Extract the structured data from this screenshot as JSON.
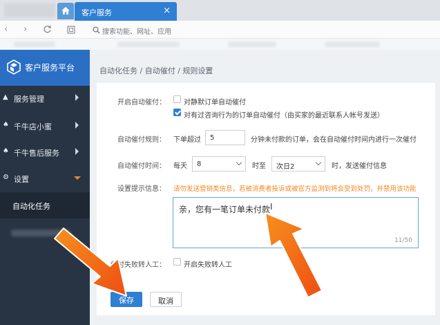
{
  "browser": {
    "tab_title": "客户服务",
    "tab_close": "×",
    "address_placeholder": "搜索功能、网址、应用"
  },
  "sidebar": {
    "brand": "客户服务平台",
    "items": [
      {
        "label": "服务管理"
      },
      {
        "label": "千牛店小蜜"
      },
      {
        "label": "千牛售后服务"
      },
      {
        "label": "设置"
      }
    ],
    "submenu": "自动化任务"
  },
  "breadcrumb": "自动化任务 / 自动催付 /  规则设置",
  "form": {
    "enable_label": "开启自动催付：",
    "opt1": "对静默订单自动催付",
    "opt2": "对有过咨询行为的订单自动催付（由买家的最近联系人帐号发送）",
    "opt1_checked": false,
    "opt2_checked": true,
    "rule_label": "自动催付规则：",
    "rule_prefix": "下单超过",
    "rule_value": "5",
    "rule_suffix": "分钟未付款的订单，会在自动催付时间内进行一次催付",
    "time_label": "自动催付时间：",
    "time_prefix": "每天",
    "time_from": "8",
    "time_mid": "时至",
    "time_to": "次日2",
    "time_suffix": "时，发送催付信息",
    "msg_label": "设置提示信息：",
    "warning": "请勿发送营销类信息，若被消费者投诉或被官方监测到将会受到处罚，并禁用该功能",
    "message": "亲，您有一笔订单未付款",
    "caret": "I",
    "count": "11/50",
    "fail_label": "催付失败转人工：",
    "fail_option": "开启失败转人工",
    "fail_checked": false
  },
  "buttons": {
    "save": "保存",
    "cancel": "取消"
  },
  "colors": {
    "accent": "#2f7fd3",
    "sidebar": "#283443",
    "warning": "#f08a24",
    "arrow": "#f26a1b"
  }
}
